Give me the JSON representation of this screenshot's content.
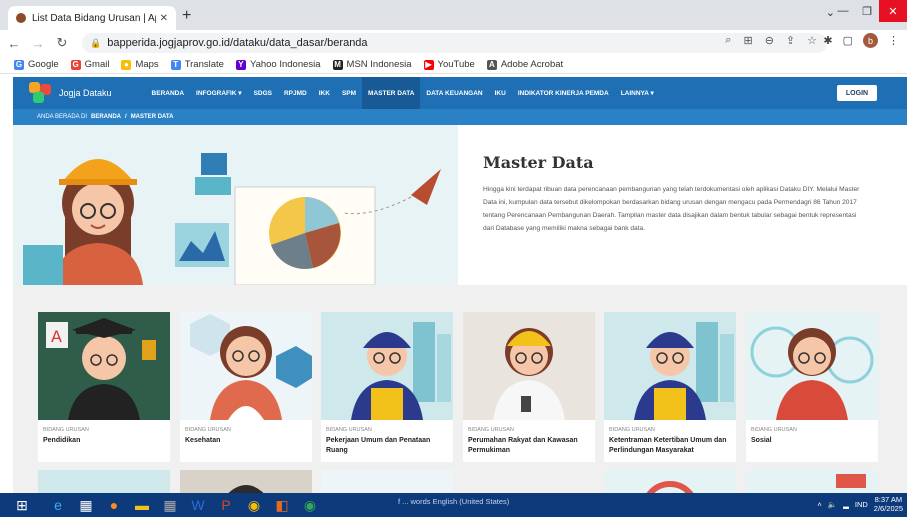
{
  "browser": {
    "tab_title": "List Data Bidang Urusan | Aplikasi",
    "url": "bapperida.jogjaprov.go.id/dataku/data_dasar/beranda",
    "profile_initial": "b",
    "bookmarks": [
      {
        "label": "Google",
        "color": "#4285f4",
        "glyph": "G"
      },
      {
        "label": "Gmail",
        "color": "#4285f4",
        "glyph": "G"
      },
      {
        "label": "Maps",
        "color": "#34a853",
        "glyph": "●"
      },
      {
        "label": "Translate",
        "color": "#4285f4",
        "glyph": "T"
      },
      {
        "label": "Yahoo Indonesia",
        "color": "#6001d2",
        "glyph": "Y"
      },
      {
        "label": "MSN Indonesia",
        "color": "#222222",
        "glyph": "M"
      },
      {
        "label": "YouTube",
        "color": "#ff0000",
        "glyph": "▶"
      },
      {
        "label": "Adobe Acrobat",
        "color": "#555555",
        "glyph": "A"
      }
    ]
  },
  "site": {
    "logo_text": "Jogja Dataku",
    "nav": [
      "BERANDA",
      "INFOGRAFIK ▾",
      "SDGS",
      "RPJMD",
      "IKK",
      "SPM",
      "MASTER DATA",
      "DATA KEUANGAN",
      "IKU",
      "INDIKATOR KINERJA PEMDA",
      "LAINNYA ▾"
    ],
    "active_nav": "MASTER DATA",
    "login_label": "LOGIN",
    "breadcrumb": {
      "prefix": "ANDA BERADA DI",
      "home": "BERANDA",
      "sep": "/",
      "current": "MASTER DATA"
    }
  },
  "hero": {
    "title": "Master Data",
    "description": "Hingga kini terdapat ribuan data perencanaan pembangunan yang telah terdokumentasi oleh aplikasi Dataku DIY. Melalui Master Data ini, kumpulan data tersebut dikelompokan berdasarkan bidang urusan dengan mengacu pada Permendagri 86 Tahun 2017 tentang Perencanaan Pembangunan Daerah. Tampilan master data disajikan dalam bentuk tabular sebagai bentuk representasi dari Database yang memiliki makna sebagai bank data."
  },
  "cards": [
    {
      "category": "BIDANG URUSAN",
      "name": "Pendidikan",
      "bg": "#2f5d4a",
      "helmet": "#2c2c2c"
    },
    {
      "category": "BIDANG URUSAN",
      "name": "Kesehatan",
      "bg": "#eaf2f6",
      "helmet": "none"
    },
    {
      "category": "BIDANG URUSAN",
      "name": "Pekerjaan Umum dan Penataan Ruang",
      "bg": "#cfe8ec",
      "helmet": "#2b3a8c"
    },
    {
      "category": "BIDANG URUSAN",
      "name": "Perumahan Rakyat dan Kawasan Permukiman",
      "bg": "#e7e2dc",
      "helmet": "#f2c21b"
    },
    {
      "category": "BIDANG URUSAN",
      "name": "Ketentraman Ketertiban Umum dan Perlindungan Masyarakat",
      "bg": "#cfe8ec",
      "helmet": "#2b3a8c"
    },
    {
      "category": "BIDANG URUSAN",
      "name": "Sosial",
      "bg": "#e6f3f5",
      "helmet": "none"
    }
  ],
  "taskbar": {
    "status_text": "f ... words   English (United States)",
    "lang": "IND",
    "time": "8:37 AM",
    "date": "2/6/2025"
  }
}
